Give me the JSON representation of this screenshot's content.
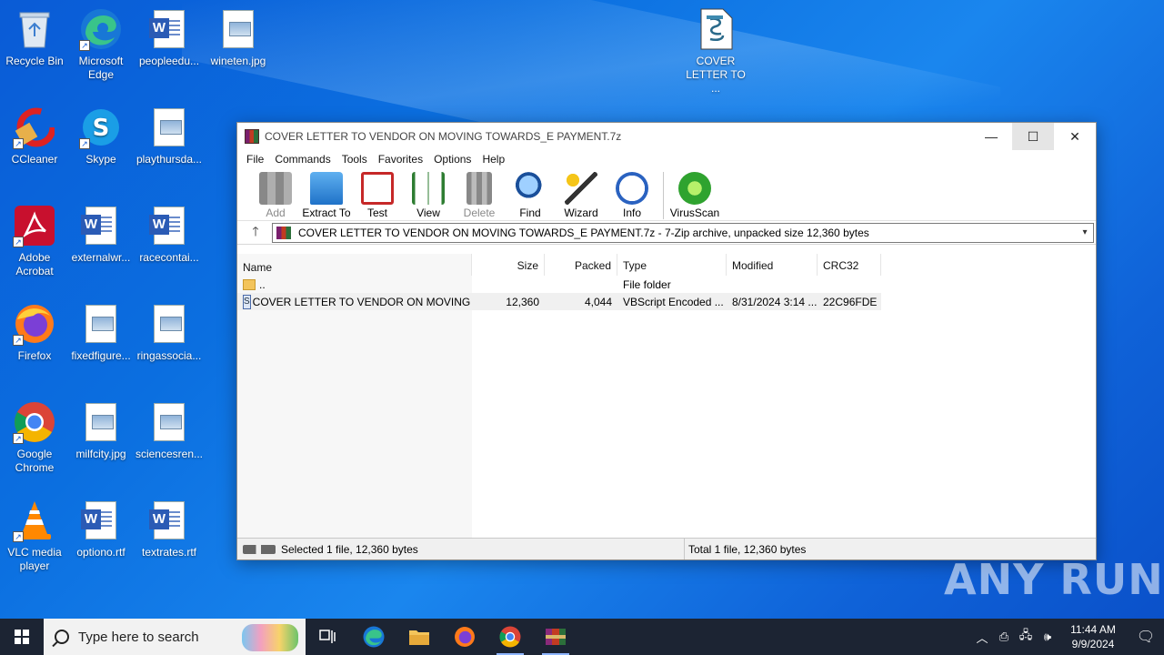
{
  "desktop": {
    "icons": [
      {
        "label": "Recycle Bin"
      },
      {
        "label": "Microsoft Edge"
      },
      {
        "label": "peopleedu..."
      },
      {
        "label": "wineten.jpg"
      },
      {
        "label": "COVER LETTER TO ..."
      },
      {
        "label": "CCleaner"
      },
      {
        "label": "Skype"
      },
      {
        "label": "playthursda..."
      },
      {
        "label": "Adobe Acrobat"
      },
      {
        "label": "externalwr..."
      },
      {
        "label": "racecontai..."
      },
      {
        "label": "Firefox"
      },
      {
        "label": "fixedfigure..."
      },
      {
        "label": "ringassocia..."
      },
      {
        "label": "Google Chrome"
      },
      {
        "label": "milfcity.jpg"
      },
      {
        "label": "sciencesren..."
      },
      {
        "label": "VLC media player"
      },
      {
        "label": "optiono.rtf"
      },
      {
        "label": "textrates.rtf"
      }
    ]
  },
  "window": {
    "title": "COVER LETTER TO VENDOR ON MOVING TOWARDS_E PAYMENT.7z",
    "controls": {
      "minimize": "—",
      "maximize": "☐",
      "close": "✕"
    },
    "menu": [
      "File",
      "Commands",
      "Tools",
      "Favorites",
      "Options",
      "Help"
    ],
    "toolbar": [
      {
        "label": "Add",
        "enabled": false
      },
      {
        "label": "Extract To",
        "enabled": true
      },
      {
        "label": "Test",
        "enabled": true
      },
      {
        "label": "View",
        "enabled": true
      },
      {
        "label": "Delete",
        "enabled": false
      },
      {
        "label": "Find",
        "enabled": true
      },
      {
        "label": "Wizard",
        "enabled": true
      },
      {
        "label": "Info",
        "enabled": true
      },
      {
        "label": "VirusScan",
        "enabled": true
      }
    ],
    "address": "COVER LETTER TO VENDOR ON MOVING TOWARDS_E PAYMENT.7z - 7-Zip archive, unpacked size 12,360 bytes",
    "columns": [
      "Name",
      "Size",
      "Packed",
      "Type",
      "Modified",
      "CRC32"
    ],
    "rows": [
      {
        "name": "..",
        "size": "",
        "packed": "",
        "type": "File folder",
        "modified": "",
        "crc": ""
      },
      {
        "name": "COVER LETTER TO VENDOR ON MOVING T...",
        "size": "12,360",
        "packed": "4,044",
        "type": "VBScript Encoded ...",
        "modified": "8/31/2024 3:14 ...",
        "crc": "22C96FDE"
      }
    ],
    "status_left": "Selected 1 file, 12,360 bytes",
    "status_right": "Total 1 file, 12,360 bytes"
  },
  "taskbar": {
    "search_placeholder": "Type here to search",
    "time": "11:44 AM",
    "date": "9/9/2024"
  },
  "watermark": "ANY RUN"
}
